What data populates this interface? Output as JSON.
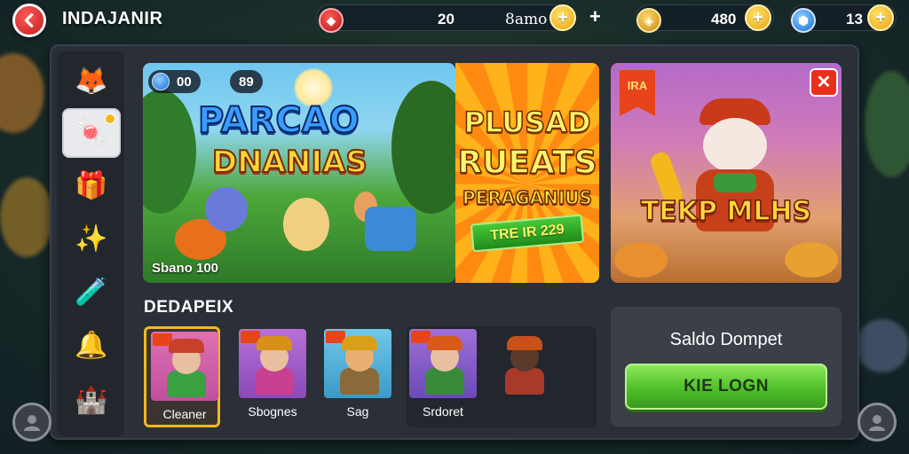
{
  "header": {
    "title": "INDAJANIR",
    "back_icon": "back-arrow-icon",
    "resources": [
      {
        "name": "rubies",
        "icon": "ruby-icon",
        "value": "20",
        "label": "8amo",
        "color": "#d82020"
      },
      {
        "name": "gold",
        "icon": "gold-coin-icon",
        "value": "480",
        "color": "#e9a412"
      },
      {
        "name": "gems",
        "icon": "blue-gem-icon",
        "value": "13",
        "color": "#1a6ad6"
      }
    ],
    "plus_label": "+"
  },
  "sidebar": {
    "items": [
      {
        "name": "profile",
        "icon": "fox-avatar-icon",
        "glyph": "🦊"
      },
      {
        "name": "shop",
        "icon": "candy-bag-icon",
        "glyph": "🍬",
        "active": true
      },
      {
        "name": "gifts",
        "icon": "gift-box-icon",
        "glyph": "🎁"
      },
      {
        "name": "magic",
        "icon": "magic-wand-icon",
        "glyph": "✨"
      },
      {
        "name": "boosts",
        "icon": "potion-icon",
        "glyph": "🧪"
      },
      {
        "name": "alerts",
        "icon": "bell-icon",
        "glyph": "🔔"
      },
      {
        "name": "guild",
        "icon": "castle-icon",
        "glyph": "🏰"
      }
    ]
  },
  "banner": {
    "title_line1": "PARCAO",
    "title_line2": "DNANIAS",
    "gem_count": "00",
    "counter": "89",
    "caption": "Sbano 100"
  },
  "promo": {
    "line1": "PLUSAD",
    "line2": "RUEATS",
    "line3": "PERAGANIUS",
    "ribbon": "TRE IR 229"
  },
  "character_card": {
    "flag_text": "IRA",
    "title": "TEKP MLHS",
    "close_label": "✕"
  },
  "heroes": {
    "section_title": "DEDAPEIX",
    "items": [
      {
        "name": "Cleaner",
        "selected": true,
        "hat": "#c8402a",
        "body": "#3aa040",
        "bg": "#d86aa8"
      },
      {
        "name": "Sbognes",
        "selected": false,
        "hat": "#d8901a",
        "body": "#c84090",
        "bg": "#a85ac8"
      },
      {
        "name": "Sag",
        "selected": false,
        "hat": "#d8a01a",
        "body": "#8a6a3a",
        "bg": "#5ab0d8"
      },
      {
        "name": "Srdoret",
        "selected": false,
        "hat": "#d85a1a",
        "body": "#3a8a3a",
        "bg": "#8a5ac8"
      },
      {
        "name": "",
        "selected": false,
        "hat": "#c8501a",
        "body": "#a83a2a",
        "bg": "#22262d"
      }
    ]
  },
  "wallet": {
    "title": "Saldo Dompet",
    "login_label": "KIE LOGN"
  },
  "colors": {
    "panel": "#2a2f38",
    "accent_gold": "#f3b81c",
    "login_green": "#4fbf2a",
    "close_red": "#e8301c"
  }
}
